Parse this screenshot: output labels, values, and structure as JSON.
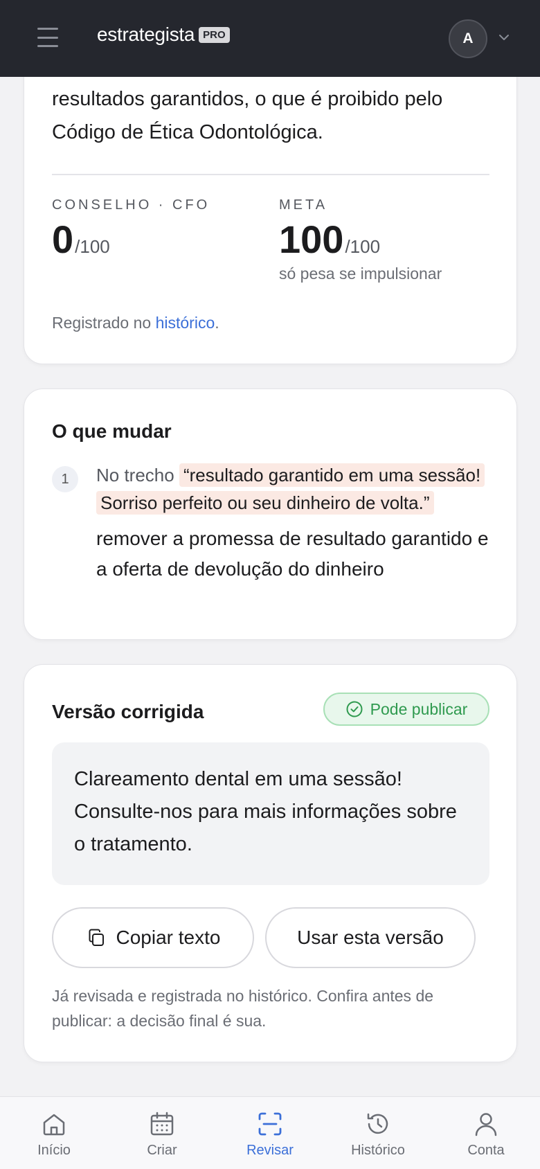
{
  "header": {
    "brand": "estrategista",
    "badge": "PRO",
    "avatar_initial": "A"
  },
  "result_card": {
    "lead_text": "resultados garantidos, o que é proibido pelo Código de Ética Odontológica.",
    "scores": [
      {
        "label": "CONSELHO · CFO",
        "value": "0",
        "max": "/100",
        "note": ""
      },
      {
        "label": "META",
        "value": "100",
        "max": "/100",
        "note": "só pesa se impulsionar"
      }
    ],
    "registered_prefix": "Registrado no",
    "registered_link": "histórico",
    "registered_suffix": "."
  },
  "changes_card": {
    "title": "O que mudar",
    "items": [
      {
        "number": "1",
        "prefix": "No trecho",
        "quote": "“resultado garantido em uma sessão! Sorriso perfeito ou seu dinheiro de volta.”",
        "action": "remover a promessa de resultado garantido e a oferta de devolução do dinheiro"
      }
    ]
  },
  "corrected_card": {
    "title": "Versão corrigida",
    "badge": "Pode publicar",
    "text": "Clareamento dental em uma sessão! Consulte-nos para mais informações sobre o tratamento.",
    "copy_button": "Copiar texto",
    "use_button": "Usar esta versão",
    "footnote": "Já revisada e registrada no histórico. Confira antes de publicar: a decisão final é sua."
  },
  "bottom_nav": {
    "items": [
      {
        "label": "Início",
        "icon": "home-icon"
      },
      {
        "label": "Criar",
        "icon": "calendar-icon"
      },
      {
        "label": "Revisar",
        "icon": "scan-icon",
        "active": true
      },
      {
        "label": "Histórico",
        "icon": "history-icon"
      },
      {
        "label": "Conta",
        "icon": "user-icon"
      }
    ]
  },
  "colors": {
    "header_bg": "#25272e",
    "accent": "#3b6fd8",
    "success": "#2f9a4f",
    "highlight": "#fbe9e3"
  }
}
